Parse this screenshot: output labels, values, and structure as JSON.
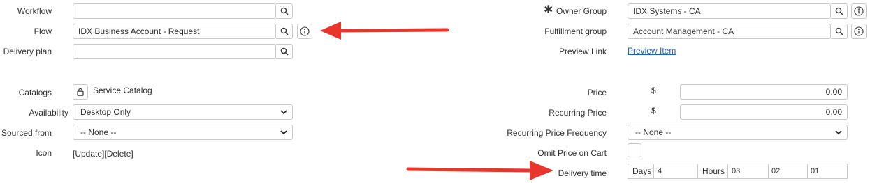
{
  "left": {
    "workflow_label": "Workflow",
    "workflow_value": "",
    "flow_label": "Flow",
    "flow_value": "IDX Business Account - Request",
    "delivery_plan_label": "Delivery plan",
    "delivery_plan_value": "",
    "catalogs_label": "Catalogs",
    "catalogs_value": "Service Catalog",
    "availability_label": "Availability",
    "availability_value": "Desktop Only",
    "sourced_from_label": "Sourced from",
    "sourced_from_value": "-- None --",
    "icon_label": "Icon",
    "icon_update": "[Update]",
    "icon_delete": "[Delete]"
  },
  "right": {
    "owner_group_label": "Owner Group",
    "owner_group_value": "IDX Systems - CA",
    "required_mark": "✱",
    "fulfillment_group_label": "Fulfillment group",
    "fulfillment_group_value": "Account Management - CA",
    "preview_link_label": "Preview Link",
    "preview_link_text": "Preview Item",
    "price_label": "Price",
    "currency_symbol": "$",
    "price_value": "0.00",
    "recurring_price_label": "Recurring Price",
    "recurring_currency_symbol": "$",
    "recurring_price_value": "0.00",
    "recurring_frequency_label": "Recurring Price Frequency",
    "recurring_frequency_value": "-- None --",
    "omit_price_label": "Omit Price on Cart",
    "delivery_time_label": "Delivery time",
    "days_label": "Days",
    "days_value": "4",
    "hours_label": "Hours",
    "hours_value": "03",
    "minutes_value": "02",
    "seconds_value": "01"
  },
  "icons": {
    "search": "search-icon",
    "info": "info-icon",
    "lock": "lock-icon",
    "chevron": "chevron-down-icon",
    "arrow": "red-arrow-annotation"
  },
  "colors": {
    "arrow": "#e8362c",
    "link": "#1d5fd1",
    "border": "#c5c9cc"
  }
}
